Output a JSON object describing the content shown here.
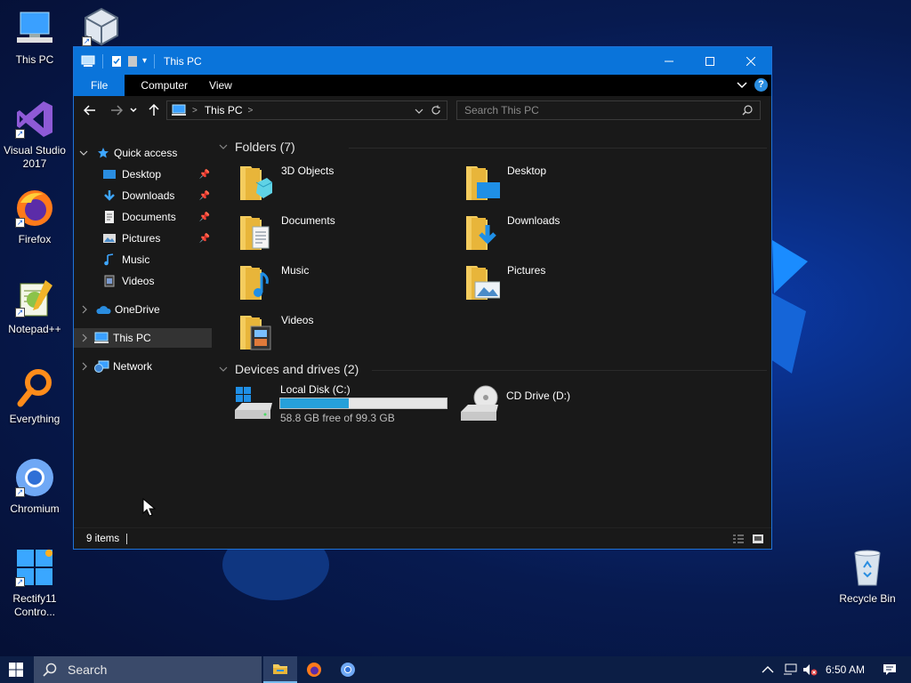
{
  "desktop": {
    "icons": [
      {
        "label": "This PC",
        "icon": "monitor-icon"
      },
      {
        "label": "",
        "icon": "virtualbox-icon"
      },
      {
        "label": "Visual Studio 2017",
        "icon": "visual-studio-icon"
      },
      {
        "label": "Firefox",
        "icon": "firefox-icon"
      },
      {
        "label": "Notepad++",
        "icon": "notepadpp-icon"
      },
      {
        "label": "Everything",
        "icon": "everything-search-icon"
      },
      {
        "label": "Chromium",
        "icon": "chromium-icon"
      },
      {
        "label": "Rectify11 Contro...",
        "icon": "rectify11-icon"
      },
      {
        "label": "Recycle Bin",
        "icon": "recycle-bin-icon"
      }
    ]
  },
  "window": {
    "title": "This PC",
    "ribbon_tabs": [
      "File",
      "Computer",
      "View"
    ],
    "address": {
      "location": "This PC"
    },
    "search": {
      "placeholder": "Search This PC"
    },
    "nav_pane": {
      "quick_access": "Quick access",
      "quick_items": [
        "Desktop",
        "Downloads",
        "Documents",
        "Pictures",
        "Music",
        "Videos"
      ],
      "onedrive": "OneDrive",
      "this_pc": "This PC",
      "network": "Network"
    },
    "folders_group": "Folders (7)",
    "folders": [
      "3D Objects",
      "Desktop",
      "Documents",
      "Downloads",
      "Music",
      "Pictures",
      "Videos"
    ],
    "drives_group": "Devices and drives (2)",
    "drives": [
      {
        "name": "Local Disk (C:)",
        "free": "58.8 GB free of 99.3 GB",
        "used_fraction": 0.41
      },
      {
        "name": "CD Drive (D:)"
      }
    ],
    "status": {
      "items": "9 items"
    }
  },
  "taskbar": {
    "search_label": "Search",
    "time": "6:50 AM"
  },
  "colors": {
    "accent": "#0a74da",
    "window_bg": "#191919",
    "drive_bar": "#26a0da"
  }
}
